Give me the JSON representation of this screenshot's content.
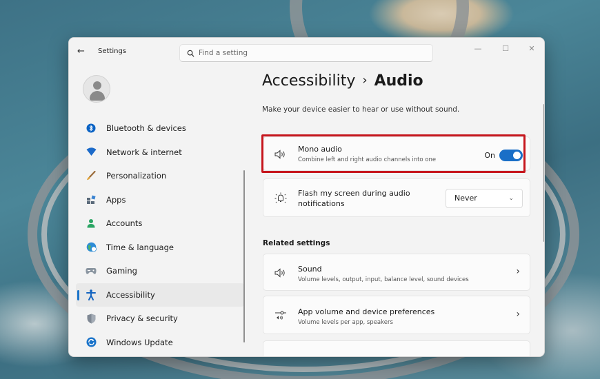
{
  "window": {
    "app_title": "Settings",
    "back_glyph": "←",
    "minimize_glyph": "—",
    "maximize_glyph": "☐",
    "close_glyph": "✕"
  },
  "search": {
    "placeholder": "Find a setting",
    "icon": "search-icon"
  },
  "sidebar": {
    "items": [
      {
        "label": "Bluetooth & devices",
        "icon": "bluetooth-icon",
        "color": "#0b63c4"
      },
      {
        "label": "Network & internet",
        "icon": "wifi-icon",
        "color": "#1b6ac9"
      },
      {
        "label": "Personalization",
        "icon": "brush-icon",
        "color": "#d48a2a"
      },
      {
        "label": "Apps",
        "icon": "apps-icon",
        "color": "#5a6a7a"
      },
      {
        "label": "Accounts",
        "icon": "person-icon",
        "color": "#2aa563"
      },
      {
        "label": "Time & language",
        "icon": "globe-clock-icon",
        "color": "#2d8cd6"
      },
      {
        "label": "Gaming",
        "icon": "gamepad-icon",
        "color": "#7a8590"
      },
      {
        "label": "Accessibility",
        "icon": "accessibility-icon",
        "color": "#1565c0",
        "active": true
      },
      {
        "label": "Privacy & security",
        "icon": "shield-icon",
        "color": "#6a7380"
      },
      {
        "label": "Windows Update",
        "icon": "update-icon",
        "color": "#1a73c9"
      }
    ]
  },
  "main": {
    "breadcrumb_parent": "Accessibility",
    "breadcrumb_sep": "›",
    "breadcrumb_current": "Audio",
    "subtitle": "Make your device easier to hear or use without sound.",
    "mono": {
      "title": "Mono audio",
      "desc": "Combine left and right audio channels into one",
      "state_label": "On",
      "toggle_on": true
    },
    "flash": {
      "title_line1": "Flash my screen during audio",
      "title_line2": "notifications",
      "dropdown_value": "Never"
    },
    "related_title": "Related settings",
    "sound": {
      "title": "Sound",
      "desc": "Volume levels, output, input, balance level, sound devices",
      "chevron": "›"
    },
    "appvol": {
      "title": "App volume and device preferences",
      "desc": "Volume levels per app, speakers",
      "chevron": "›"
    }
  },
  "colors": {
    "accent": "#1a6fc7",
    "highlight": "#c6161d"
  }
}
